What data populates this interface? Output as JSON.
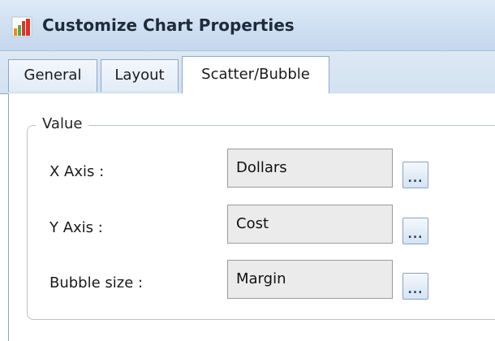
{
  "window": {
    "title": "Customize Chart Properties",
    "icon": "bar-chart-icon"
  },
  "tabs": [
    {
      "label": "General",
      "active": false
    },
    {
      "label": "Layout",
      "active": false
    },
    {
      "label": "Scatter/Bubble",
      "active": true
    }
  ],
  "value_group": {
    "legend": "Value",
    "rows": [
      {
        "label": "X Axis :",
        "value": "Dollars",
        "button": "..."
      },
      {
        "label": "Y Axis :",
        "value": "Cost",
        "button": "..."
      },
      {
        "label": "Bubble size :",
        "value": "Margin",
        "button": "..."
      }
    ]
  },
  "colors": {
    "titlebar": "#cfdff2",
    "tab_border": "#8ea7c6",
    "field_bg": "#ebebeb"
  }
}
